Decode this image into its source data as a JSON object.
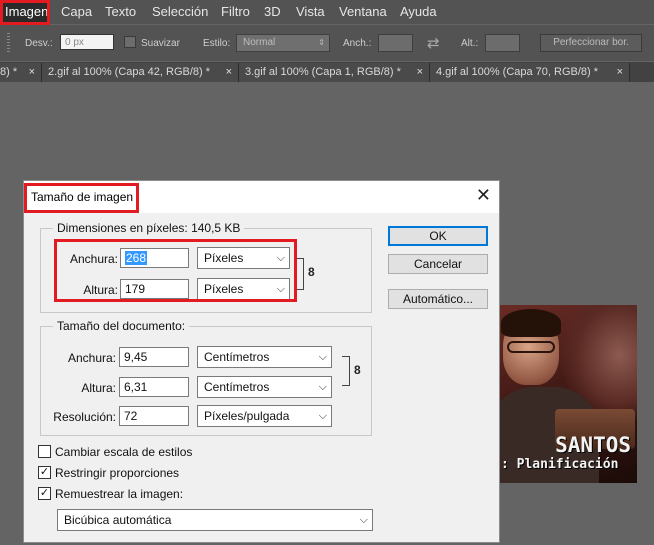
{
  "menu": {
    "items": [
      "Imagen",
      "Capa",
      "Texto",
      "Selección",
      "Filtro",
      "3D",
      "Vista",
      "Ventana",
      "Ayuda"
    ]
  },
  "options_bar": {
    "feather_label": "Desv.:",
    "feather_value": "0 px",
    "smooth_label": "Suavizar",
    "style_label": "Estilo:",
    "style_value": "Normal",
    "width_label": "Anch.:",
    "height_label": "Alt.:",
    "refine_button": "Perfeccionar bor."
  },
  "tabs": [
    {
      "label": "8) *"
    },
    {
      "label": "2.gif al 100% (Capa 42, RGB/8) *"
    },
    {
      "label": "3.gif al 100% (Capa 1, RGB/8) *"
    },
    {
      "label": "4.gif al 100% (Capa 70, RGB/8) *"
    }
  ],
  "tab_close": "×",
  "thumbnail": {
    "title": "SANTOS",
    "subtitle": ": Planificación"
  },
  "dialog": {
    "title": "Tamaño de imagen",
    "close": "✕",
    "pixel_dimensions": {
      "legend": "Dimensiones en píxeles: 140,5 KB",
      "width_label": "Anchura:",
      "width_value": "268",
      "width_unit": "Píxeles",
      "height_label": "Altura:",
      "height_value": "179",
      "height_unit": "Píxeles"
    },
    "document_size": {
      "legend": "Tamaño del documento:",
      "width_label": "Anchura:",
      "width_value": "9,45",
      "width_unit": "Centímetros",
      "height_label": "Altura:",
      "height_value": "6,31",
      "height_unit": "Centímetros",
      "resolution_label": "Resolución:",
      "resolution_value": "72",
      "resolution_unit": "Píxeles/pulgada"
    },
    "buttons": {
      "ok": "OK",
      "cancel": "Cancelar",
      "auto": "Automático..."
    },
    "checkboxes": [
      {
        "label": "Cambiar escala de estilos",
        "checked": false
      },
      {
        "label": "Restringir proporciones",
        "checked": true
      },
      {
        "label": "Remuestrear la imagen:",
        "checked": true
      }
    ],
    "resample_method": "Bicúbica automática"
  },
  "colors": {
    "highlight_red": "#e21b23",
    "selection_blue": "#3399ff",
    "workspace_gray": "#646464"
  }
}
